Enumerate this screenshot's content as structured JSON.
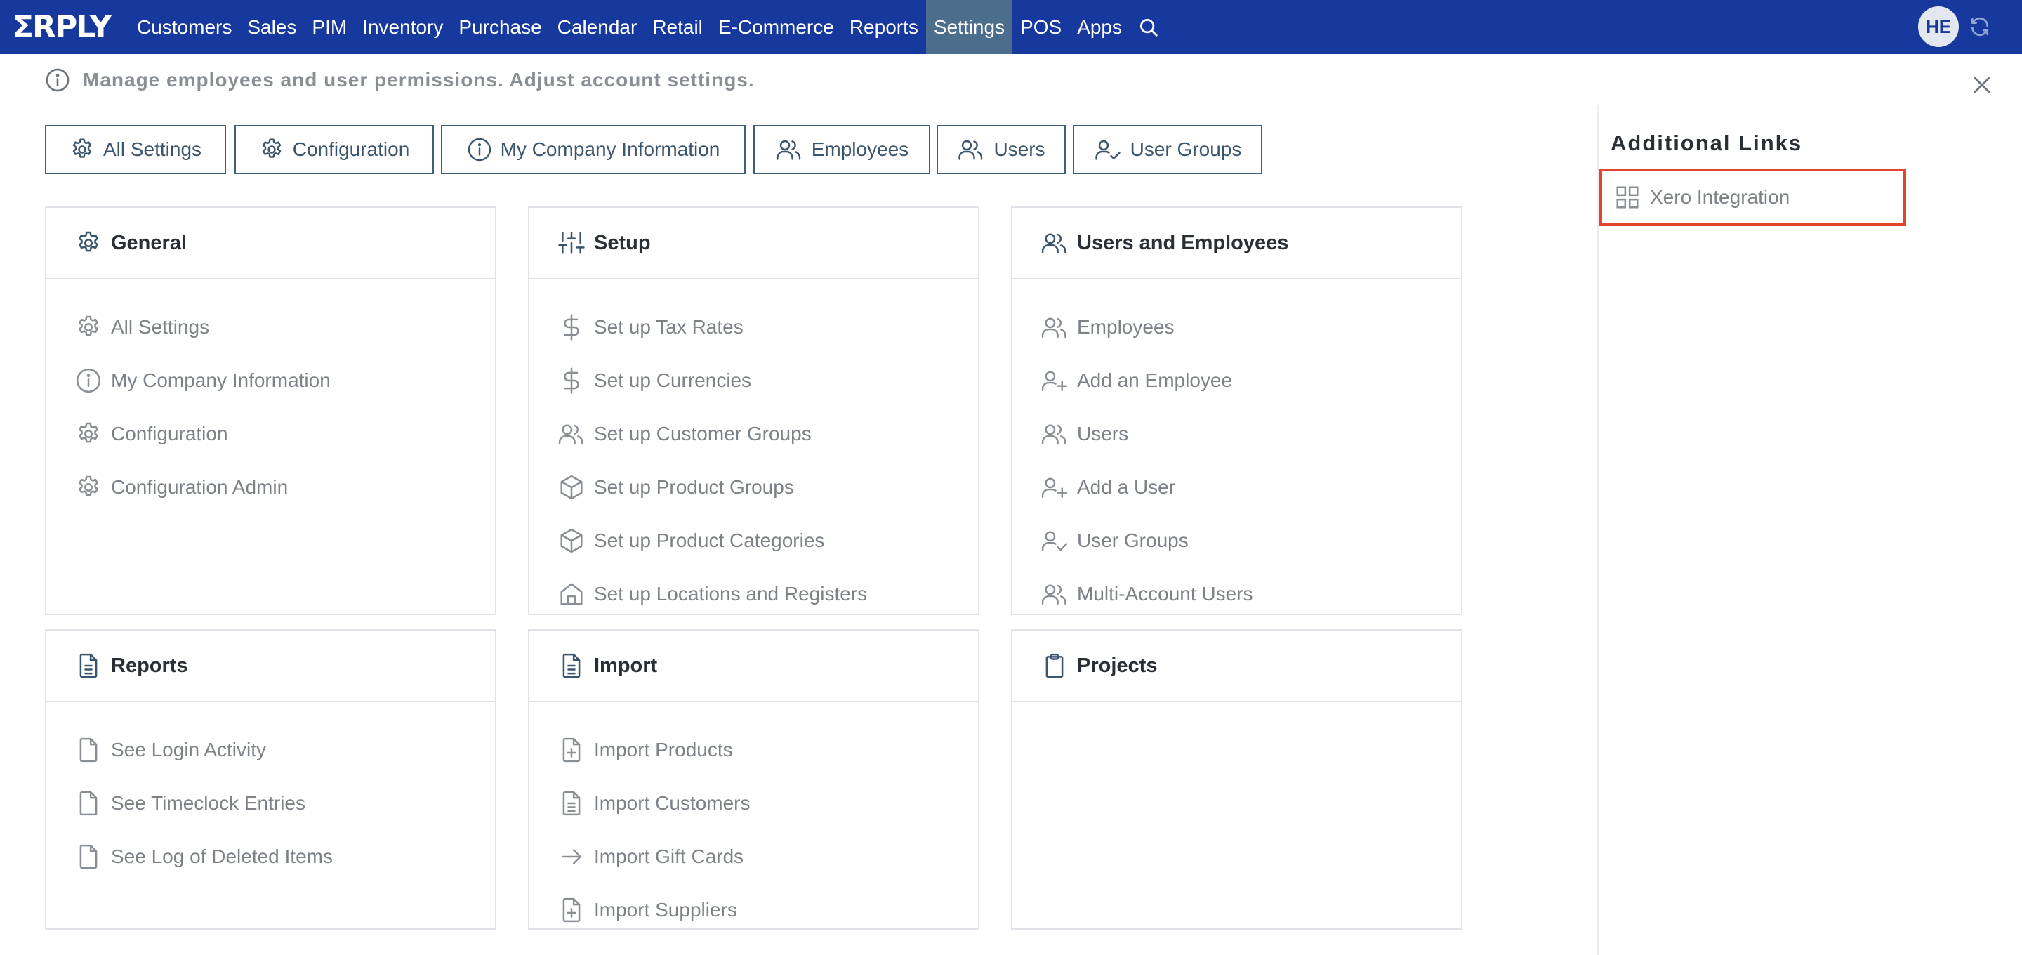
{
  "brand": {
    "logo_text": "ΣRPLY"
  },
  "nav": {
    "items": [
      "Customers",
      "Sales",
      "PIM",
      "Inventory",
      "Purchase",
      "Calendar",
      "Retail",
      "E-Commerce",
      "Reports",
      "Settings",
      "POS",
      "Apps"
    ],
    "active": "Settings",
    "search_icon": "search-icon"
  },
  "user": {
    "initials": "HE"
  },
  "info": {
    "text": "Manage employees and user permissions. Adjust account settings."
  },
  "top_buttons": [
    {
      "label": "All Settings",
      "icon": "gear-icon"
    },
    {
      "label": "Configuration",
      "icon": "gear-icon"
    },
    {
      "label": "My Company Information",
      "icon": "info-icon"
    },
    {
      "label": "Employees",
      "icon": "users-icon"
    },
    {
      "label": "Users",
      "icon": "users-icon"
    },
    {
      "label": "User Groups",
      "icon": "user-check-icon"
    }
  ],
  "cards": {
    "general": {
      "title": "General",
      "items": [
        "All Settings",
        "My Company Information",
        "Configuration",
        "Configuration Admin"
      ]
    },
    "setup": {
      "title": "Setup",
      "items": [
        "Set up Tax Rates",
        "Set up Currencies",
        "Set up Customer Groups",
        "Set up Product Groups",
        "Set up Product Categories",
        "Set up Locations and Registers"
      ]
    },
    "users": {
      "title": "Users and Employees",
      "items": [
        "Employees",
        "Add an Employee",
        "Users",
        "Add a User",
        "User Groups",
        "Multi-Account Users"
      ]
    },
    "reports": {
      "title": "Reports",
      "items": [
        "See Login Activity",
        "See Timeclock Entries",
        "See Log of Deleted Items"
      ]
    },
    "import": {
      "title": "Import",
      "items": [
        "Import Products",
        "Import Customers",
        "Import Gift Cards",
        "Import Suppliers"
      ]
    },
    "projects": {
      "title": "Projects",
      "items": []
    }
  },
  "side": {
    "title": "Additional Links",
    "link": "Xero Integration"
  },
  "colors": {
    "nav_bg": "#17399e",
    "nav_active": "#4d6d8c",
    "button_border": "#3f5f7a",
    "highlight": "#e2452c"
  }
}
